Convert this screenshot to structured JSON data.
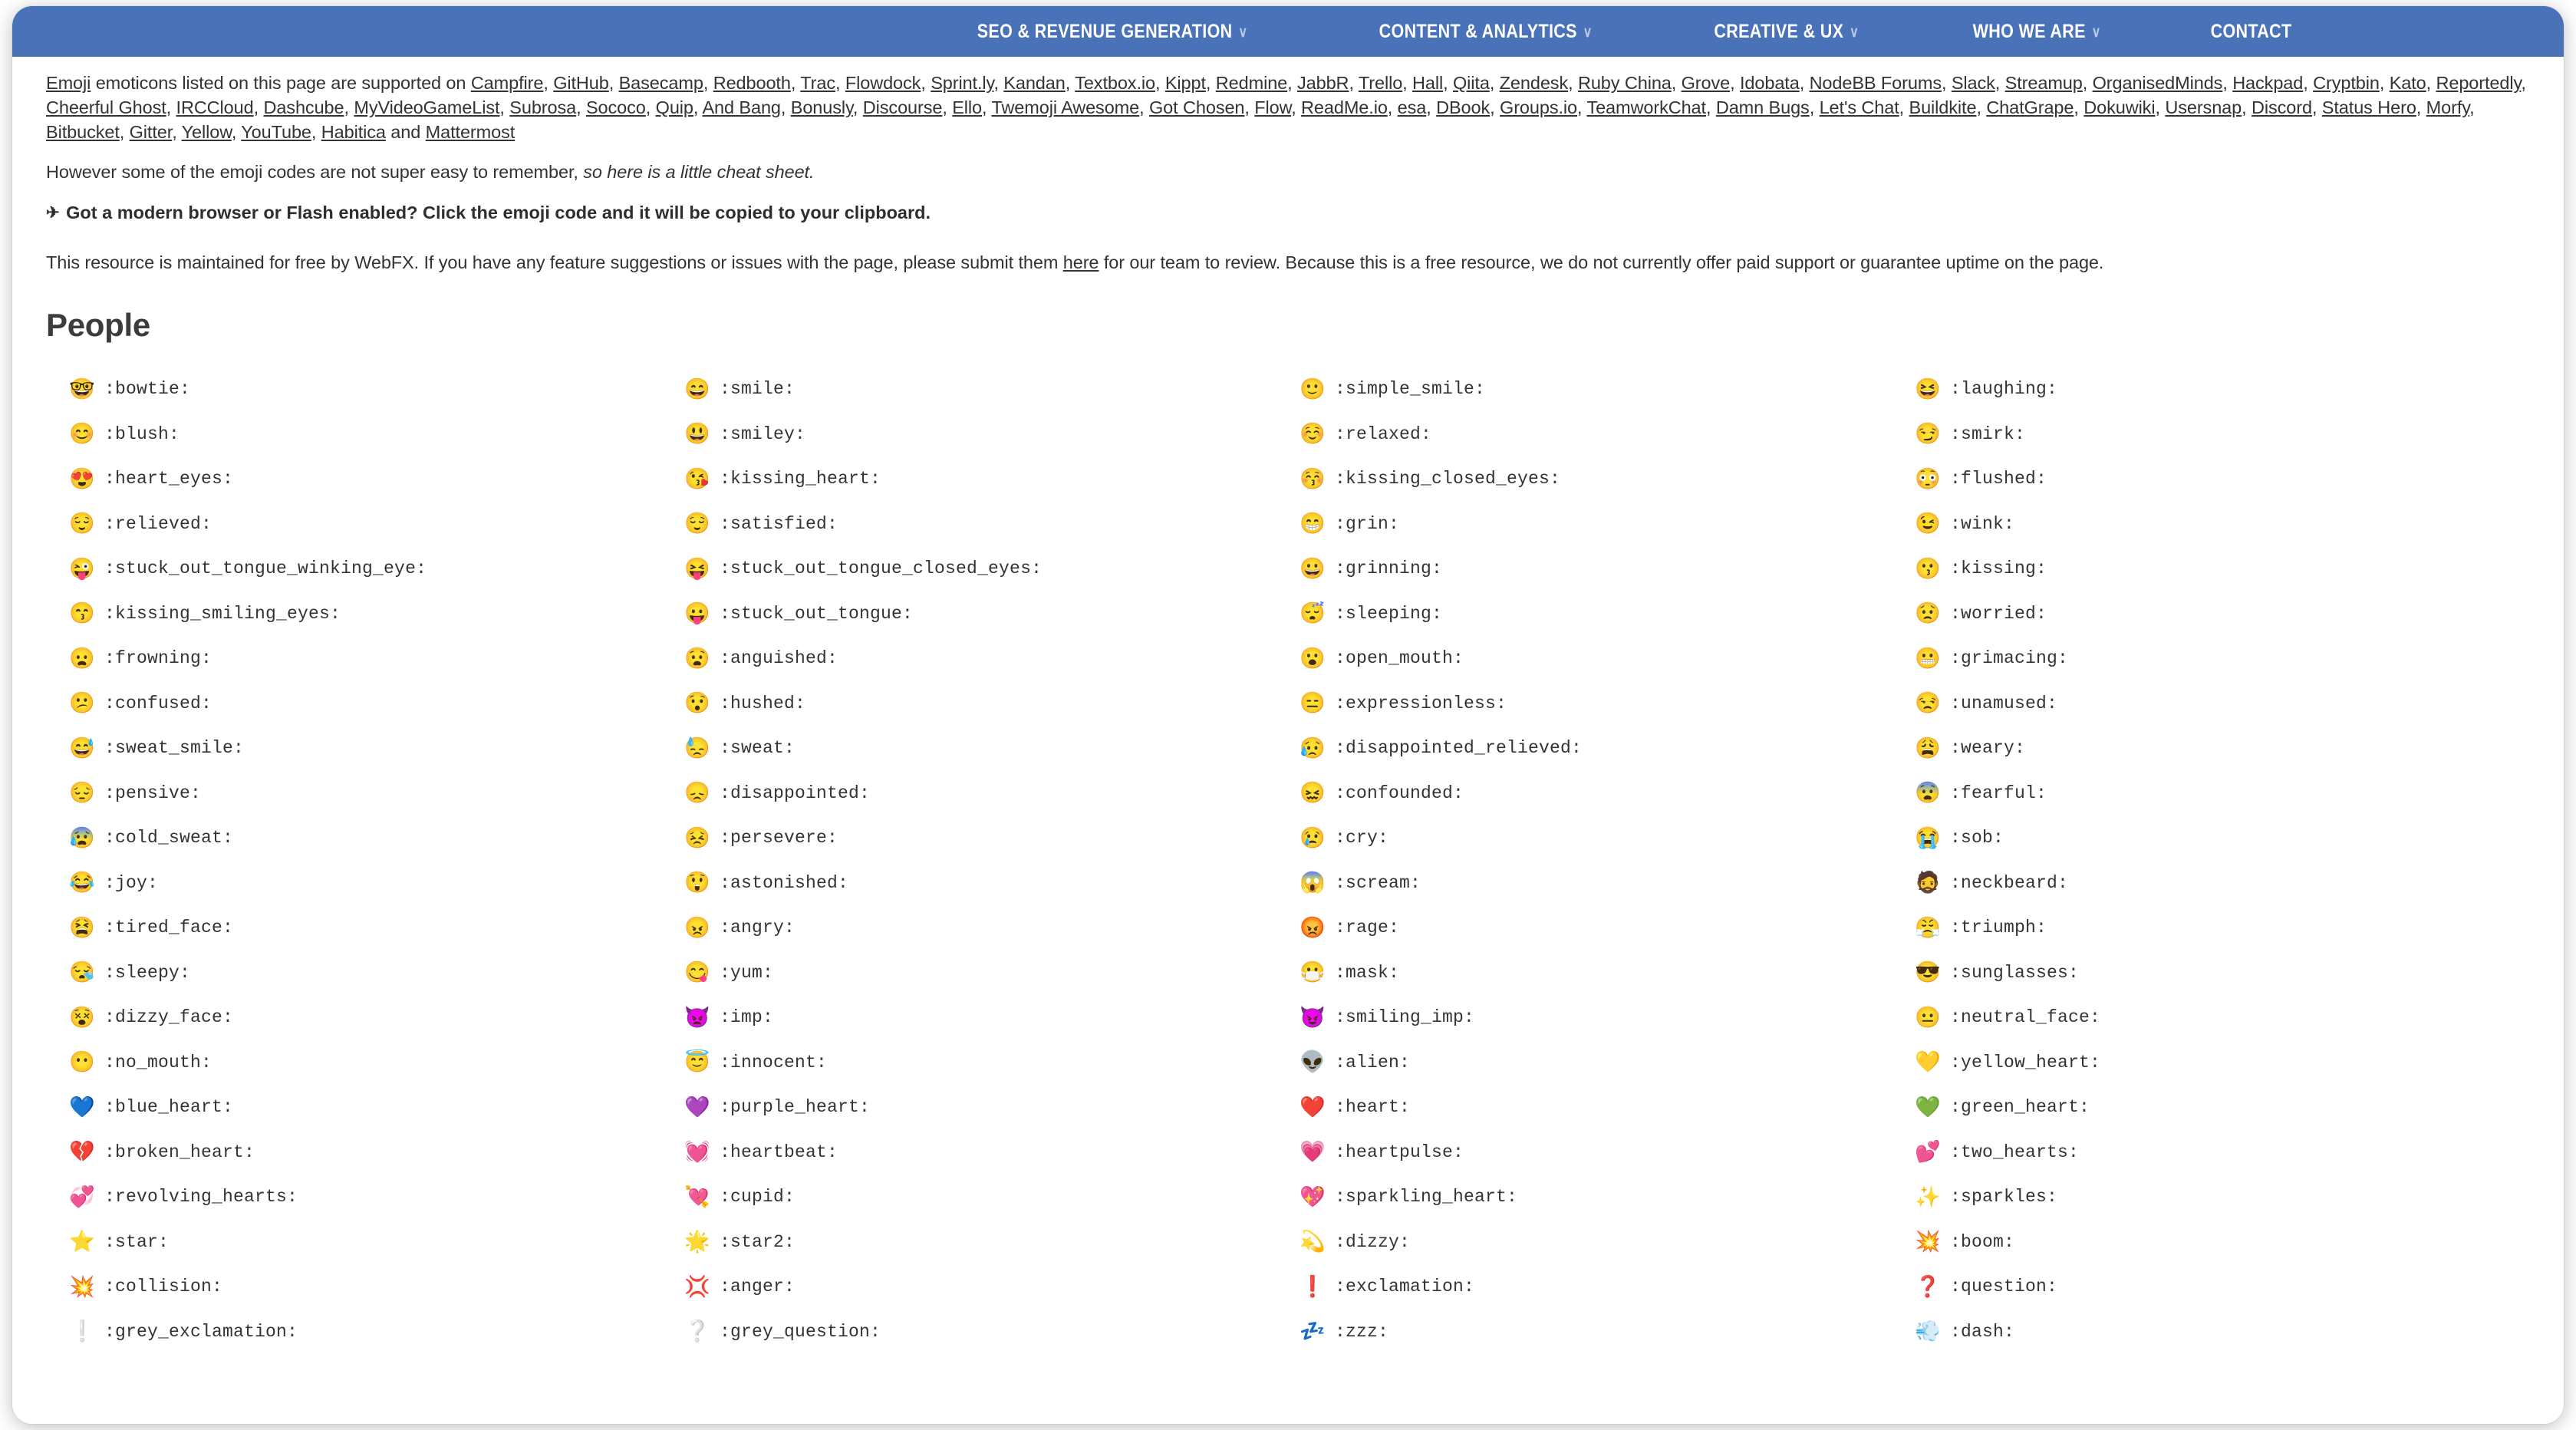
{
  "window": {
    "background_color": "#ffffff"
  },
  "nav": {
    "background_color": "#4a72b8",
    "text_color": "#ffffff",
    "items": [
      {
        "label": "SEO & REVENUE GENERATION",
        "has_caret": true,
        "caret": "∨"
      },
      {
        "label": "CONTENT & ANALYTICS",
        "has_caret": true,
        "caret": "∨"
      },
      {
        "label": "CREATIVE & UX",
        "has_caret": true,
        "caret": "∨"
      },
      {
        "label": "WHO WE ARE",
        "has_caret": true,
        "caret": "∨"
      },
      {
        "label": "CONTACT",
        "has_caret": false,
        "caret": ""
      }
    ]
  },
  "intro": {
    "supported_prefix_link": "Emoji",
    "supported_text": " emoticons listed on this page are supported on ",
    "supported_links": [
      "Campfire",
      "GitHub",
      "Basecamp",
      "Redbooth",
      "Trac",
      "Flowdock",
      "Sprint.ly",
      "Kandan",
      "Textbox.io",
      "Kippt",
      "Redmine",
      "JabbR",
      "Trello",
      "Hall",
      "Qiita",
      "Zendesk",
      "Ruby China",
      "Grove",
      "Idobata",
      "NodeBB Forums",
      "Slack",
      "Streamup",
      "OrganisedMinds",
      "Hackpad",
      "Cryptbin",
      "Kato",
      "Reportedly",
      "Cheerful Ghost",
      "IRCCloud",
      "Dashcube",
      "MyVideoGameList",
      "Subrosa",
      "Sococo",
      "Quip",
      "And Bang",
      "Bonusly",
      "Discourse",
      "Ello",
      "Twemoji Awesome",
      "Got Chosen",
      "Flow",
      "ReadMe.io",
      "esa",
      "DBook",
      "Groups.io",
      "TeamworkChat",
      "Damn Bugs",
      "Let's Chat",
      "Buildkite",
      "ChatGrape",
      "Dokuwiki",
      "Usersnap",
      "Discord",
      "Status Hero",
      "Morfy",
      "Bitbucket",
      "Gitter",
      "Yellow",
      "YouTube",
      "Habitica"
    ],
    "supported_conjunction": " and ",
    "supported_last_link": "Mattermost",
    "however_text": "However some of the emoji codes are not super easy to remember, ",
    "however_italic": "so here is a little cheat sheet.",
    "clipboard_glyph": "✈",
    "clipboard_text": "Got a modern browser or Flash enabled? Click the emoji code and it will be copied to your clipboard.",
    "maintained_part1": "This resource is maintained for free by WebFX. If you have any feature suggestions or issues with the page, please submit them ",
    "maintained_link": "here",
    "maintained_part2": " for our team to review. Because this is a free resource, we do not currently offer paid support or guarantee uptime on the page."
  },
  "section": {
    "heading": "People"
  },
  "emoji_grid": {
    "columns": 4,
    "items": [
      {
        "glyph": "🤓",
        "code": ":bowtie:"
      },
      {
        "glyph": "😄",
        "code": ":smile:"
      },
      {
        "glyph": "🙂",
        "code": ":simple_smile:"
      },
      {
        "glyph": "😆",
        "code": ":laughing:"
      },
      {
        "glyph": "😊",
        "code": ":blush:"
      },
      {
        "glyph": "😃",
        "code": ":smiley:"
      },
      {
        "glyph": "☺️",
        "code": ":relaxed:"
      },
      {
        "glyph": "😏",
        "code": ":smirk:"
      },
      {
        "glyph": "😍",
        "code": ":heart_eyes:"
      },
      {
        "glyph": "😘",
        "code": ":kissing_heart:"
      },
      {
        "glyph": "😚",
        "code": ":kissing_closed_eyes:"
      },
      {
        "glyph": "😳",
        "code": ":flushed:"
      },
      {
        "glyph": "😌",
        "code": ":relieved:"
      },
      {
        "glyph": "😌",
        "code": ":satisfied:"
      },
      {
        "glyph": "😁",
        "code": ":grin:"
      },
      {
        "glyph": "😉",
        "code": ":wink:"
      },
      {
        "glyph": "😜",
        "code": ":stuck_out_tongue_winking_eye:"
      },
      {
        "glyph": "😝",
        "code": ":stuck_out_tongue_closed_eyes:"
      },
      {
        "glyph": "😀",
        "code": ":grinning:"
      },
      {
        "glyph": "😗",
        "code": ":kissing:"
      },
      {
        "glyph": "😙",
        "code": ":kissing_smiling_eyes:"
      },
      {
        "glyph": "😛",
        "code": ":stuck_out_tongue:"
      },
      {
        "glyph": "😴",
        "code": ":sleeping:"
      },
      {
        "glyph": "😟",
        "code": ":worried:"
      },
      {
        "glyph": "😦",
        "code": ":frowning:"
      },
      {
        "glyph": "😧",
        "code": ":anguished:"
      },
      {
        "glyph": "😮",
        "code": ":open_mouth:"
      },
      {
        "glyph": "😬",
        "code": ":grimacing:"
      },
      {
        "glyph": "😕",
        "code": ":confused:"
      },
      {
        "glyph": "😯",
        "code": ":hushed:"
      },
      {
        "glyph": "😑",
        "code": ":expressionless:"
      },
      {
        "glyph": "😒",
        "code": ":unamused:"
      },
      {
        "glyph": "😅",
        "code": ":sweat_smile:"
      },
      {
        "glyph": "😓",
        "code": ":sweat:"
      },
      {
        "glyph": "😥",
        "code": ":disappointed_relieved:"
      },
      {
        "glyph": "😩",
        "code": ":weary:"
      },
      {
        "glyph": "😔",
        "code": ":pensive:"
      },
      {
        "glyph": "😞",
        "code": ":disappointed:"
      },
      {
        "glyph": "😖",
        "code": ":confounded:"
      },
      {
        "glyph": "😨",
        "code": ":fearful:"
      },
      {
        "glyph": "😰",
        "code": ":cold_sweat:"
      },
      {
        "glyph": "😣",
        "code": ":persevere:"
      },
      {
        "glyph": "😢",
        "code": ":cry:"
      },
      {
        "glyph": "😭",
        "code": ":sob:"
      },
      {
        "glyph": "😂",
        "code": ":joy:"
      },
      {
        "glyph": "😲",
        "code": ":astonished:"
      },
      {
        "glyph": "😱",
        "code": ":scream:"
      },
      {
        "glyph": "🧔",
        "code": ":neckbeard:"
      },
      {
        "glyph": "😫",
        "code": ":tired_face:"
      },
      {
        "glyph": "😠",
        "code": ":angry:"
      },
      {
        "glyph": "😡",
        "code": ":rage:"
      },
      {
        "glyph": "😤",
        "code": ":triumph:"
      },
      {
        "glyph": "😪",
        "code": ":sleepy:"
      },
      {
        "glyph": "😋",
        "code": ":yum:"
      },
      {
        "glyph": "😷",
        "code": ":mask:"
      },
      {
        "glyph": "😎",
        "code": ":sunglasses:"
      },
      {
        "glyph": "😵",
        "code": ":dizzy_face:"
      },
      {
        "glyph": "👿",
        "code": ":imp:"
      },
      {
        "glyph": "😈",
        "code": ":smiling_imp:"
      },
      {
        "glyph": "😐",
        "code": ":neutral_face:"
      },
      {
        "glyph": "😶",
        "code": ":no_mouth:"
      },
      {
        "glyph": "😇",
        "code": ":innocent:"
      },
      {
        "glyph": "👽",
        "code": ":alien:"
      },
      {
        "glyph": "💛",
        "code": ":yellow_heart:"
      },
      {
        "glyph": "💙",
        "code": ":blue_heart:"
      },
      {
        "glyph": "💜",
        "code": ":purple_heart:"
      },
      {
        "glyph": "❤️",
        "code": ":heart:"
      },
      {
        "glyph": "💚",
        "code": ":green_heart:"
      },
      {
        "glyph": "💔",
        "code": ":broken_heart:"
      },
      {
        "glyph": "💓",
        "code": ":heartbeat:"
      },
      {
        "glyph": "💗",
        "code": ":heartpulse:"
      },
      {
        "glyph": "💕",
        "code": ":two_hearts:"
      },
      {
        "glyph": "💞",
        "code": ":revolving_hearts:"
      },
      {
        "glyph": "💘",
        "code": ":cupid:"
      },
      {
        "glyph": "💖",
        "code": ":sparkling_heart:"
      },
      {
        "glyph": "✨",
        "code": ":sparkles:"
      },
      {
        "glyph": "⭐",
        "code": ":star:"
      },
      {
        "glyph": "🌟",
        "code": ":star2:"
      },
      {
        "glyph": "💫",
        "code": ":dizzy:"
      },
      {
        "glyph": "💥",
        "code": ":boom:"
      },
      {
        "glyph": "💥",
        "code": ":collision:"
      },
      {
        "glyph": "💢",
        "code": ":anger:"
      },
      {
        "glyph": "❗",
        "code": ":exclamation:"
      },
      {
        "glyph": "❓",
        "code": ":question:"
      },
      {
        "glyph": "❕",
        "code": ":grey_exclamation:"
      },
      {
        "glyph": "❔",
        "code": ":grey_question:"
      },
      {
        "glyph": "💤",
        "code": ":zzz:"
      },
      {
        "glyph": "💨",
        "code": ":dash:"
      }
    ]
  }
}
